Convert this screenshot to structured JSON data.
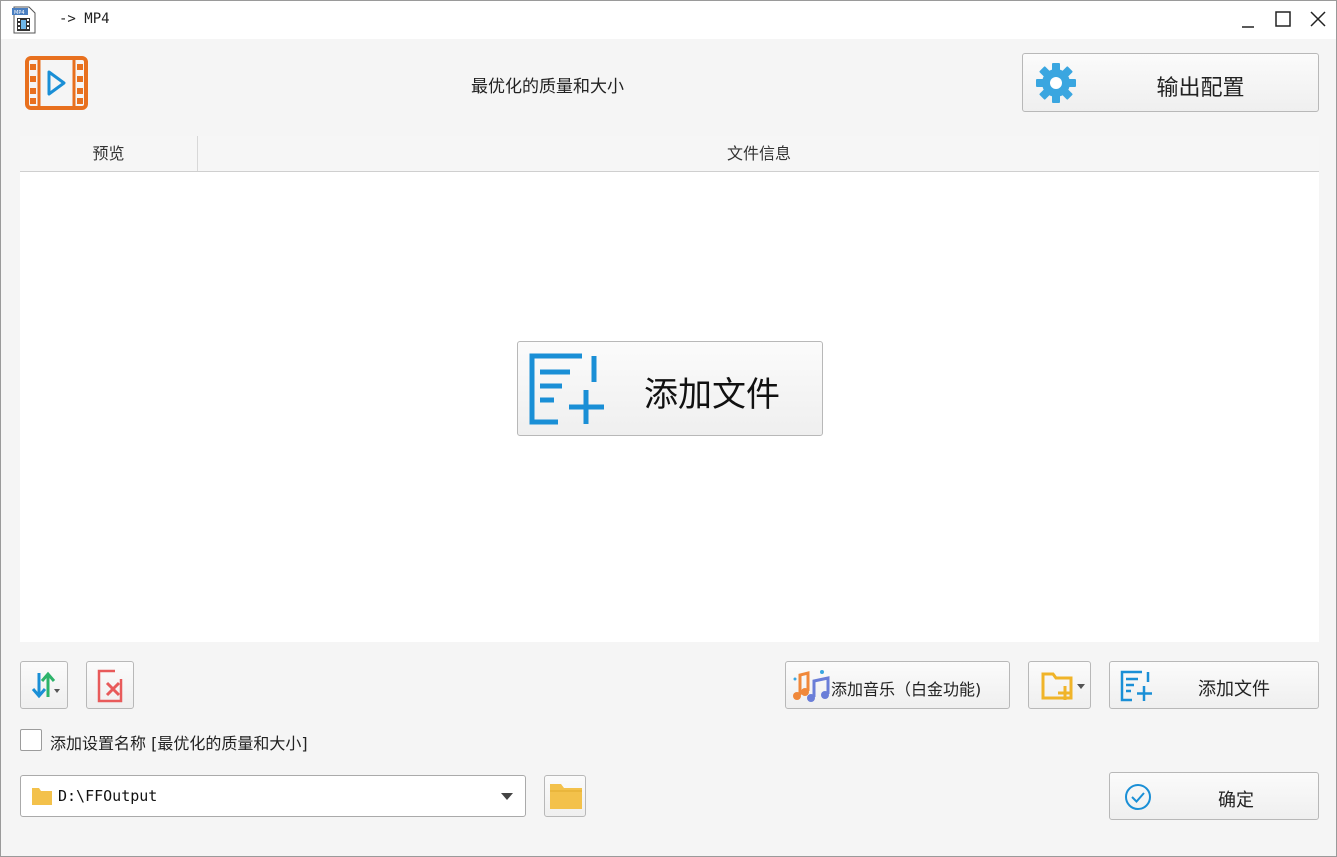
{
  "window": {
    "title": "-> MP4",
    "app_icon": "mp4-file-icon",
    "controls": [
      "minimize-icon",
      "maximize-icon",
      "close-icon"
    ]
  },
  "header": {
    "logo": "video-file-icon",
    "preset_name": "最优化的质量和大小",
    "output_button": {
      "label": "输出配置",
      "icon": "gear-icon"
    }
  },
  "file_list": {
    "columns": [
      "预览",
      "文件信息"
    ],
    "rows": [],
    "add_files_button": {
      "label": "添加文件",
      "icon": "add-file-icon"
    }
  },
  "toolbar": {
    "sort_button_icon": "sort-icon",
    "clear_button_icon": "clear-list-icon",
    "add_music_button": {
      "label": "添加音乐（白金功能)",
      "icon": "music-icon"
    },
    "add_folder_button_icon": "add-folder-icon",
    "add_files_button": {
      "label": "添加文件",
      "icon": "add-file-icon"
    }
  },
  "options": {
    "add_preset_name_checkbox": {
      "checked": false,
      "label": "添加设置名称 [最优化的质量和大小]"
    }
  },
  "output": {
    "folder_path": "D:\\FFOutput",
    "browse_icon": "folder-icon"
  },
  "confirm_button": {
    "label": "确定",
    "icon": "check-circle-icon"
  },
  "colors": {
    "accent_blue": "#1a8fd6",
    "logo_orange": "#e8701e",
    "gear_blue": "#3aa6e0",
    "folder_yellow": "#f3c14b",
    "clear_red": "#e85a5a"
  }
}
